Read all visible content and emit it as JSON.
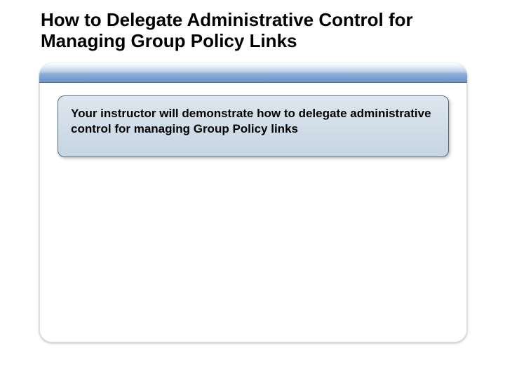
{
  "slide": {
    "title": "How to Delegate Administrative Control for Managing Group Policy Links"
  },
  "callout": {
    "text": "Your instructor will demonstrate how to delegate administrative control for managing Group Policy links"
  }
}
